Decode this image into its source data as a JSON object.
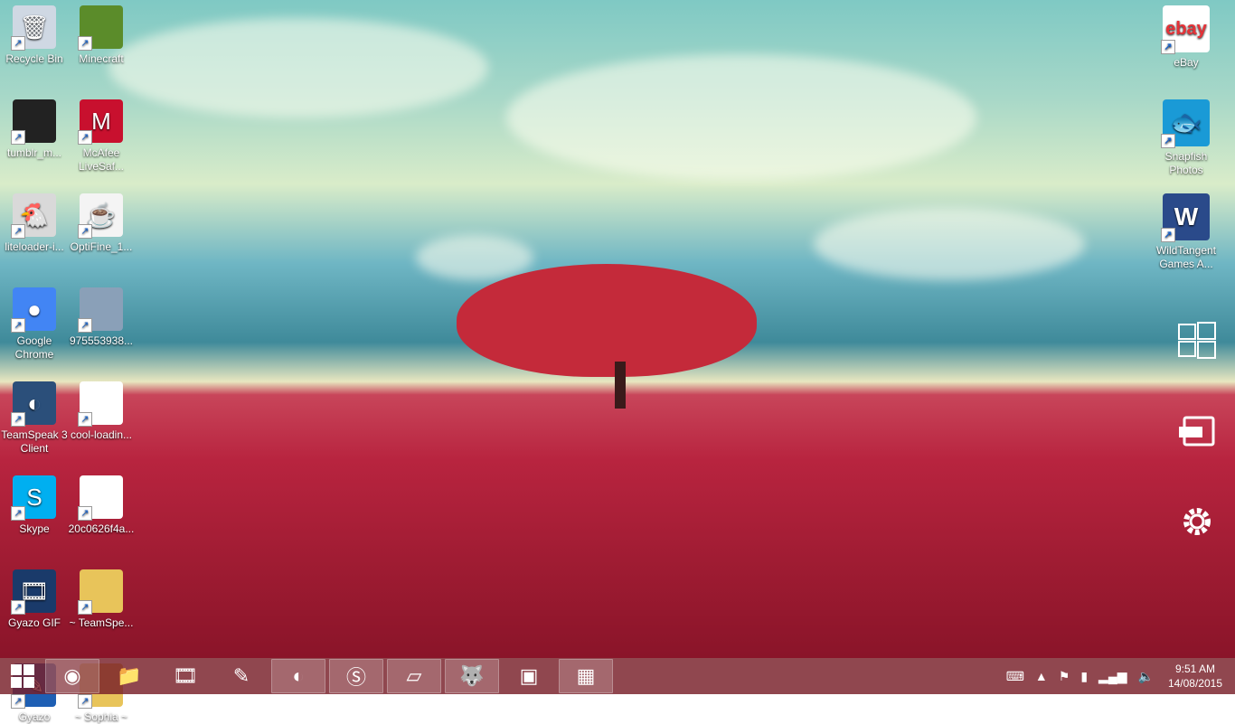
{
  "desktop": {
    "icons": [
      {
        "label": "Recycle Bin",
        "icon": "recycle-bin-icon",
        "glyph": "🗑",
        "color": "#cfd8e3"
      },
      {
        "label": "Minecraft",
        "icon": "minecraft-icon",
        "glyph": "",
        "color": "#5b8c2a"
      },
      {
        "label": "tumblr_m...",
        "icon": "image-file-icon",
        "glyph": "",
        "color": "#222222"
      },
      {
        "label": "McAfee LiveSaf...",
        "icon": "mcafee-icon",
        "glyph": "M",
        "color": "#c8102e"
      },
      {
        "label": "liteloader-i...",
        "icon": "liteloader-icon",
        "glyph": "🐔",
        "color": "#d9d9d9"
      },
      {
        "label": "OptiFine_1...",
        "icon": "java-icon",
        "glyph": "☕",
        "color": "#f4f4f4"
      },
      {
        "label": "Google Chrome",
        "icon": "chrome-icon",
        "glyph": "●",
        "color": "#4285f4"
      },
      {
        "label": "975553938...",
        "icon": "image-file-icon",
        "glyph": "",
        "color": "#8aa0b8"
      },
      {
        "label": "TeamSpeak 3 Client",
        "icon": "teamspeak-icon",
        "glyph": "◐",
        "color": "#2b4f7a"
      },
      {
        "label": "cool-loadin...",
        "icon": "image-file-icon",
        "glyph": "",
        "color": "#ffffff"
      },
      {
        "label": "Skype",
        "icon": "skype-icon",
        "glyph": "S",
        "color": "#00aff0"
      },
      {
        "label": "20c0626f4a...",
        "icon": "document-file-icon",
        "glyph": "",
        "color": "#ffffff"
      },
      {
        "label": "Gyazo GIF",
        "icon": "gyazo-gif-icon",
        "glyph": "🎞",
        "color": "#1a3a6a"
      },
      {
        "label": "~ TeamSpe...",
        "icon": "folder-icon",
        "glyph": "",
        "color": "#e8c45a"
      },
      {
        "label": "Gyazo",
        "icon": "gyazo-icon",
        "glyph": "✎",
        "color": "#1e5fb4"
      },
      {
        "label": "~ Sophia ~",
        "icon": "folder-icon",
        "glyph": "",
        "color": "#e8c45a"
      }
    ],
    "right_icons": [
      {
        "label": "eBay",
        "icon": "ebay-icon",
        "glyph": "ebay",
        "color": "#ffffff"
      },
      {
        "label": "Snapfish Photos",
        "icon": "snapfish-icon",
        "glyph": "🐟",
        "color": "#1a9ad6"
      },
      {
        "label": "WildTangent Games A...",
        "icon": "wildtangent-icon",
        "glyph": "W",
        "color": "#2a4a8a"
      }
    ]
  },
  "charms": [
    {
      "name": "start-charm",
      "icon": "windows-logo-icon",
      "glyph": "⊞"
    },
    {
      "name": "devices-charm",
      "icon": "devices-icon",
      "glyph": "▭"
    },
    {
      "name": "settings-charm",
      "icon": "gear-icon",
      "glyph": "⚙"
    }
  ],
  "taskbar": {
    "buttons": [
      {
        "name": "chrome",
        "icon": "chrome-icon",
        "glyph": "◉",
        "active": true
      },
      {
        "name": "file-explorer",
        "icon": "folder-icon",
        "glyph": "📁",
        "active": false
      },
      {
        "name": "gyazo-gif",
        "icon": "gyazo-gif-icon",
        "glyph": "🎞",
        "active": false
      },
      {
        "name": "gyazo",
        "icon": "gyazo-icon",
        "glyph": "✎",
        "active": false
      },
      {
        "name": "teamspeak",
        "icon": "teamspeak-icon",
        "glyph": "◐",
        "active": true
      },
      {
        "name": "skype",
        "icon": "skype-icon",
        "glyph": "Ⓢ",
        "active": true
      },
      {
        "name": "sticky-notes",
        "icon": "sticky-notes-icon",
        "glyph": "▱",
        "active": true
      },
      {
        "name": "gimp",
        "icon": "gimp-icon",
        "glyph": "🐺",
        "active": true
      },
      {
        "name": "minecraft",
        "icon": "minecraft-icon",
        "glyph": "▣",
        "active": false
      },
      {
        "name": "minecraft-crafting",
        "icon": "crafting-table-icon",
        "glyph": "▦",
        "active": true
      }
    ],
    "tray": {
      "clock_time": "9:51 AM",
      "clock_date": "14/08/2015"
    }
  }
}
